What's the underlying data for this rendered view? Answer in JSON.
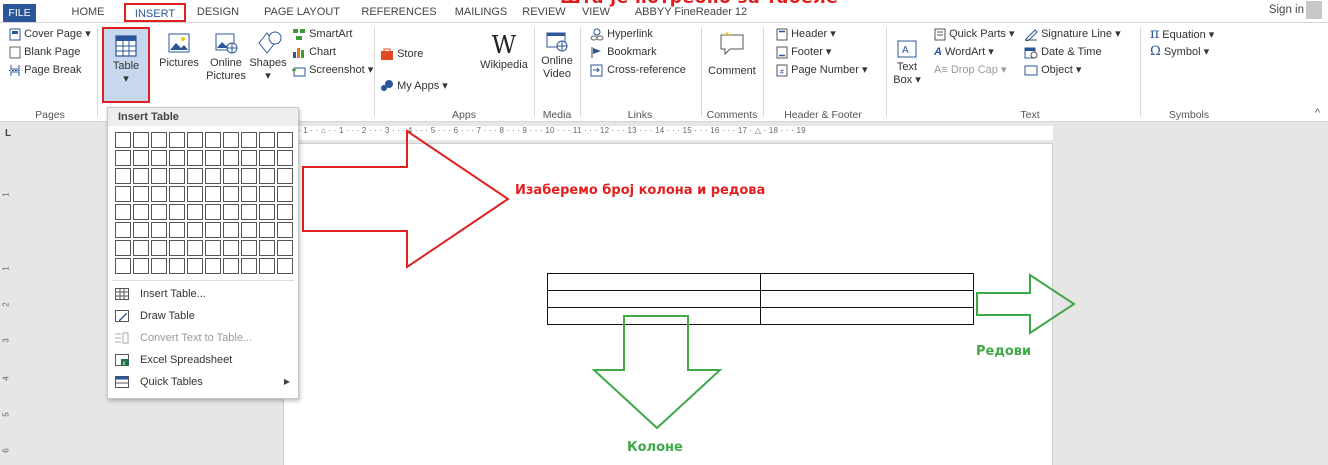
{
  "title_fragment": "Шта је потребно за табеле",
  "tabs": [
    "FILE",
    "HOME",
    "INSERT",
    "DESIGN",
    "PAGE LAYOUT",
    "REFERENCES",
    "MAILINGS",
    "REVIEW",
    "VIEW",
    "ABBYY FineReader 12"
  ],
  "active_tab": "INSERT",
  "sign_in": "Sign in",
  "ribbon": {
    "pages": {
      "cover_page": "Cover Page",
      "blank_page": "Blank Page",
      "page_break": "Page Break",
      "label": "Pages"
    },
    "tables": {
      "table": "Table"
    },
    "illustrations": {
      "pictures": "Pictures",
      "online_pictures_1": "Online",
      "online_pictures_2": "Pictures",
      "shapes": "Shapes",
      "smartart": "SmartArt",
      "chart": "Chart",
      "screenshot": "Screenshot"
    },
    "apps": {
      "store": "Store",
      "my_apps": "My Apps",
      "wikipedia": "Wikipedia",
      "label": "Apps"
    },
    "media": {
      "online_video_1": "Online",
      "online_video_2": "Video",
      "label": "Media"
    },
    "links": {
      "hyperlink": "Hyperlink",
      "bookmark": "Bookmark",
      "cross_reference": "Cross-reference",
      "label": "Links"
    },
    "comments": {
      "comment": "Comment",
      "label": "Comments"
    },
    "header_footer": {
      "header": "Header",
      "footer": "Footer",
      "page_number": "Page Number",
      "label": "Header & Footer"
    },
    "text": {
      "text_box_1": "Text",
      "text_box_2": "Box",
      "quick_parts": "Quick Parts",
      "wordart": "WordArt",
      "drop_cap": "Drop Cap",
      "signature_line": "Signature Line",
      "date_time": "Date & Time",
      "object": "Object",
      "label": "Text"
    },
    "symbols": {
      "equation": "Equation",
      "symbol": "Symbol",
      "label": "Symbols"
    }
  },
  "ruler": {
    "marks": "· 1 · · ⌂ · · 1 · · · 2 · · · 3 · · · 4 · · · 5 · · · 6 · · · 7 · · · 8 · · · 9 · · · 10 · · · 11 · · · 12 · · · 13 · · · 14 · · · 15 · · · 16 · · · 17 · △ · 18 · · · 19",
    "vertical": [
      "1",
      "1",
      "2",
      "3",
      "4",
      "5",
      "6"
    ]
  },
  "insert_table_menu": {
    "header": "Insert Table",
    "grid": {
      "columns": 10,
      "rows": 8
    },
    "items": [
      {
        "label": "Insert Table...",
        "enabled": true
      },
      {
        "label": "Draw Table",
        "enabled": true
      },
      {
        "label": "Convert Text to Table...",
        "enabled": false
      },
      {
        "label": "Excel Spreadsheet",
        "enabled": true
      },
      {
        "label": "Quick Tables",
        "enabled": true,
        "submenu": true
      }
    ]
  },
  "document_table": {
    "columns": 2,
    "rows": 3
  },
  "annotations": {
    "select_text": "Изаберемо број колона и редова",
    "rows_text": "Редови",
    "columns_text": "Колоне"
  },
  "colors": {
    "tab_blue": "#2b579a",
    "highlight_red": "#e02020",
    "annotation_red": "#e31e1e",
    "annotation_green": "#3fa847"
  }
}
